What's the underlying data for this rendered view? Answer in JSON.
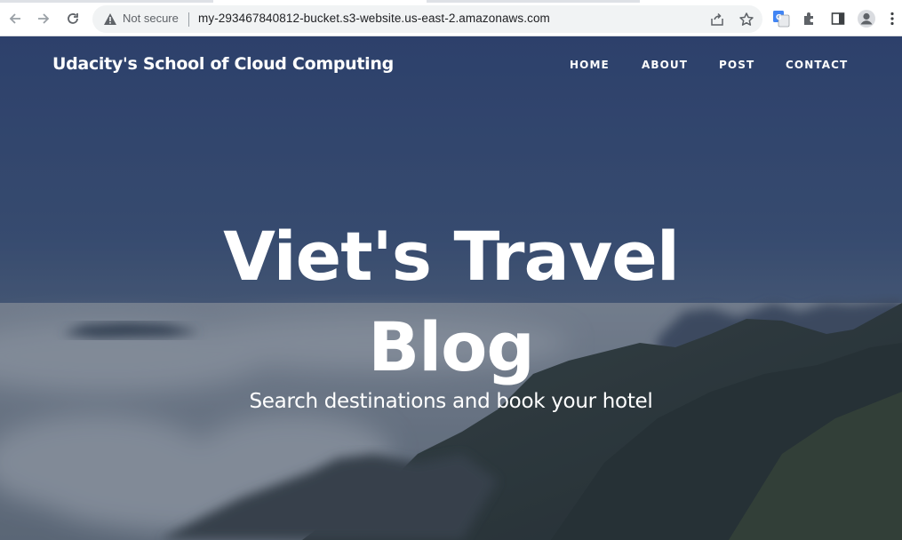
{
  "browser": {
    "security_label": "Not secure",
    "url": "my-293467840812-bucket.s3-website.us-east-2.amazonaws.com",
    "icons": [
      "back-arrow-icon",
      "forward-arrow-icon",
      "reload-icon",
      "warning-icon",
      "share-icon",
      "star-icon",
      "translate-icon",
      "extensions-icon",
      "side-panel-icon",
      "profile-icon",
      "menu-icon"
    ]
  },
  "site": {
    "brand": "Udacity's School of Cloud Computing",
    "nav": [
      "HOME",
      "ABOUT",
      "POST",
      "CONTACT"
    ],
    "title_line1": "Viet's Travel",
    "title_line2": "Blog",
    "subtitle": "Search destinations and book your hotel"
  },
  "colors": {
    "sky_top": "#33497a",
    "sky_mid": "#4b6283",
    "mountain_dark": "#2e3838",
    "text": "#ffffff"
  }
}
